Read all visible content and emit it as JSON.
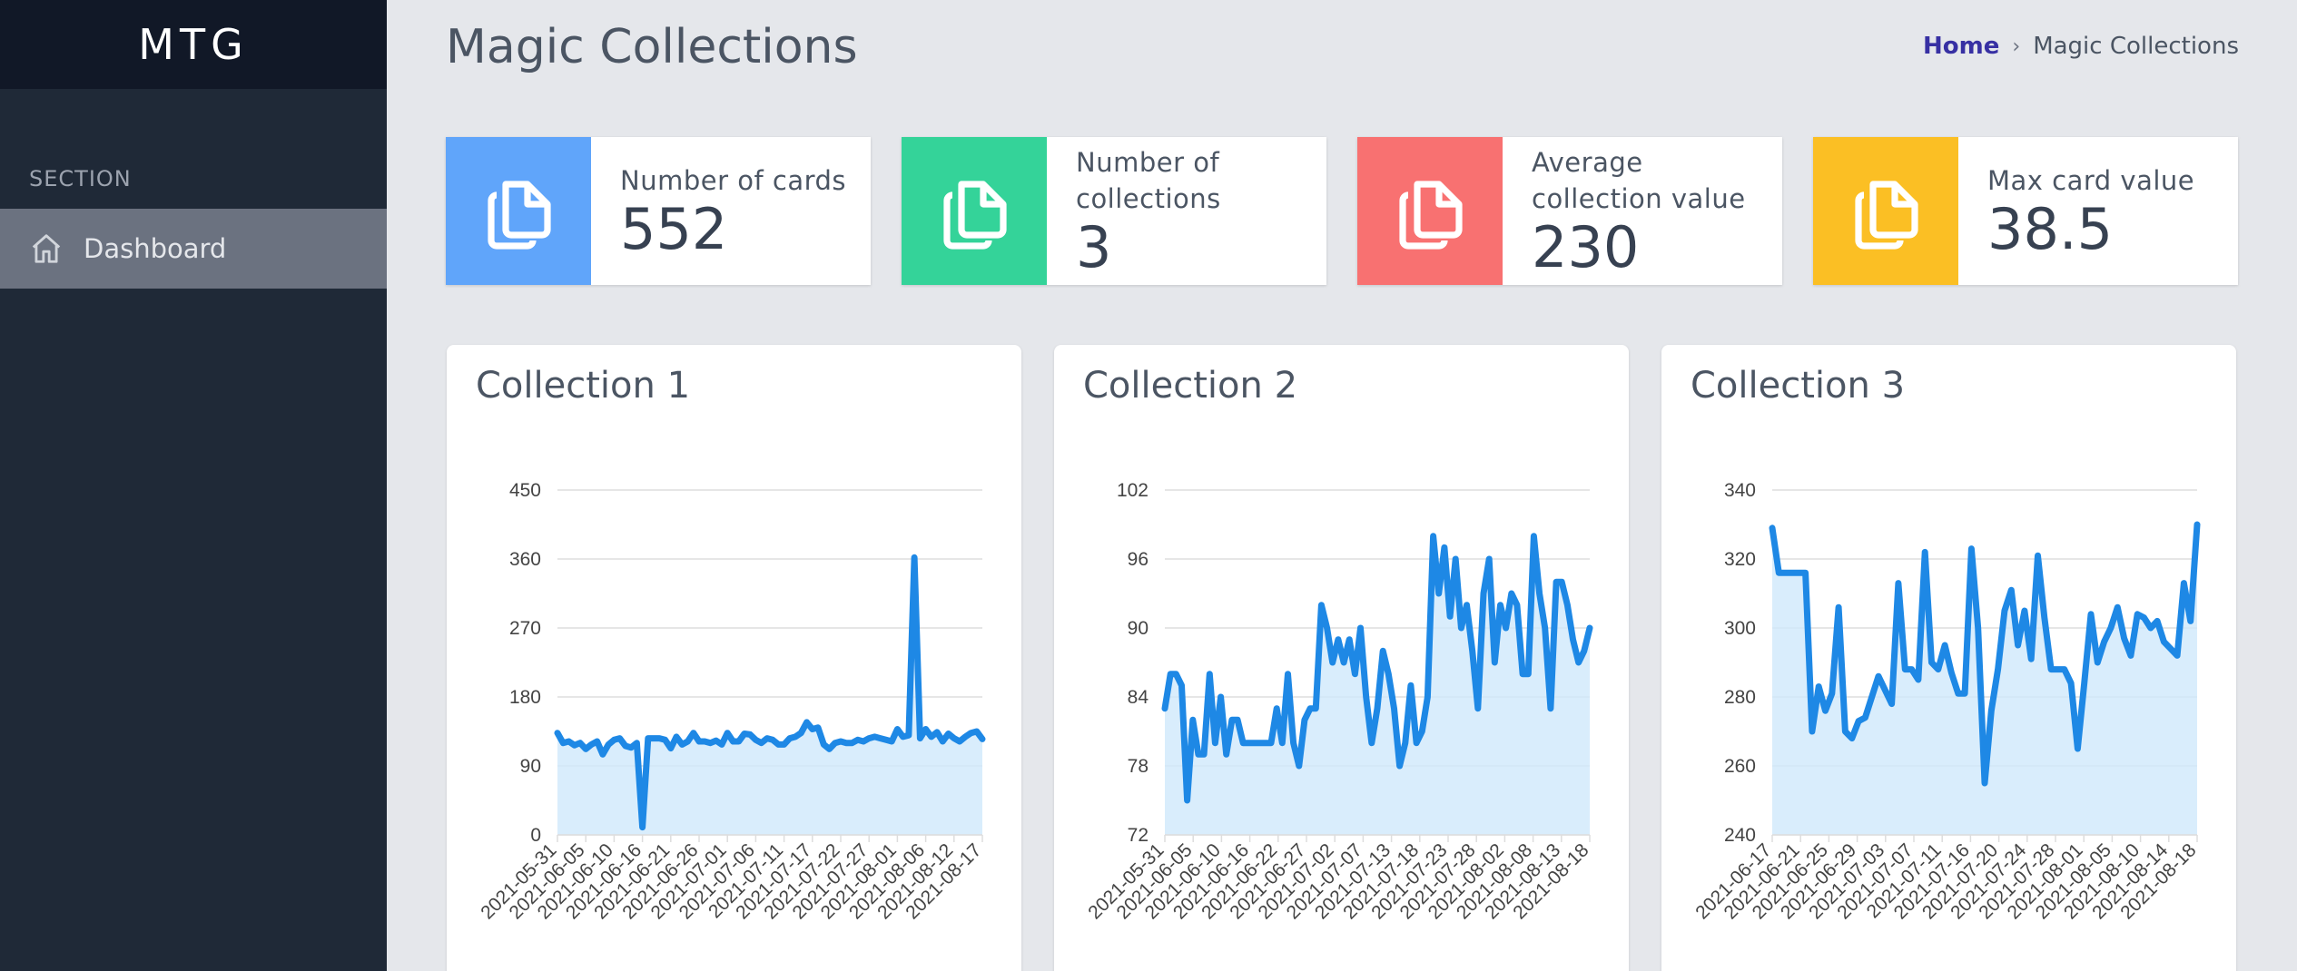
{
  "app": {
    "brand": "MTG"
  },
  "sidebar": {
    "section_label": "SECTION",
    "items": [
      {
        "label": "Dashboard",
        "icon": "home-icon"
      }
    ]
  },
  "header": {
    "title": "Magic Collections",
    "breadcrumb": {
      "home": "Home",
      "separator": "›",
      "current": "Magic Collections"
    }
  },
  "stats": [
    {
      "label": "Number of cards",
      "value": "552",
      "color": "#60a5fa",
      "icon": "copy-icon"
    },
    {
      "label": "Number of collections",
      "value": "3",
      "color": "#34d399",
      "icon": "copy-icon"
    },
    {
      "label": "Average collection value",
      "value": "230",
      "color": "#f87171",
      "icon": "copy-icon"
    },
    {
      "label": "Max card value",
      "value": "38.5",
      "color": "#fbbf24",
      "icon": "copy-icon"
    }
  ],
  "colors": {
    "line": "#1e88e5",
    "fill": "#cfe8fb"
  },
  "chart_data": [
    {
      "type": "area",
      "title": "Collection 1",
      "ylim": [
        0,
        450
      ],
      "yticks": [
        0,
        90,
        180,
        270,
        360,
        450
      ],
      "xticks": [
        "2021-05-31",
        "2021-06-05",
        "2021-06-10",
        "2021-06-16",
        "2021-06-21",
        "2021-06-26",
        "2021-07-01",
        "2021-07-06",
        "2021-07-11",
        "2021-07-17",
        "2021-07-22",
        "2021-07-27",
        "2021-08-01",
        "2021-08-06",
        "2021-08-12",
        "2021-08-17"
      ],
      "values": [
        133,
        120,
        122,
        117,
        120,
        112,
        118,
        122,
        105,
        118,
        124,
        126,
        116,
        114,
        120,
        10,
        126,
        126,
        126,
        124,
        113,
        128,
        118,
        122,
        133,
        122,
        122,
        120,
        123,
        118,
        133,
        122,
        122,
        132,
        131,
        124,
        120,
        126,
        124,
        118,
        118,
        126,
        128,
        133,
        147,
        138,
        140,
        118,
        112,
        120,
        122,
        120,
        120,
        124,
        122,
        126,
        128,
        126,
        124,
        122,
        138,
        128,
        130,
        362,
        126,
        138,
        128,
        134,
        122,
        132,
        126,
        122,
        128,
        133,
        135,
        125
      ]
    },
    {
      "type": "area",
      "title": "Collection 2",
      "ylim": [
        72,
        102
      ],
      "yticks": [
        72,
        78,
        84,
        90,
        96,
        102
      ],
      "xticks": [
        "2021-05-31",
        "2021-06-05",
        "2021-06-10",
        "2021-06-16",
        "2021-06-22",
        "2021-06-27",
        "2021-07-02",
        "2021-07-07",
        "2021-07-13",
        "2021-07-18",
        "2021-07-23",
        "2021-07-28",
        "2021-08-02",
        "2021-08-08",
        "2021-08-13",
        "2021-08-18"
      ],
      "values": [
        83,
        86,
        86,
        85,
        75,
        82,
        79,
        79,
        86,
        80,
        84,
        79,
        82,
        82,
        80,
        80,
        80,
        80,
        80,
        80,
        83,
        80,
        86,
        80,
        78,
        82,
        83,
        83,
        92,
        90,
        87,
        89,
        87,
        89,
        86,
        90,
        84,
        80,
        83,
        88,
        86,
        83,
        78,
        80,
        85,
        80,
        81,
        84,
        98,
        93,
        97,
        91,
        96,
        90,
        92,
        88,
        83,
        93,
        96,
        87,
        92,
        90,
        93,
        92,
        86,
        86,
        98,
        93,
        90,
        83,
        94,
        94,
        92,
        89,
        87,
        88,
        90
      ]
    },
    {
      "type": "area",
      "title": "Collection 3",
      "ylim": [
        240,
        340
      ],
      "yticks": [
        240,
        260,
        280,
        300,
        320,
        340
      ],
      "xticks": [
        "2021-06-17",
        "2021-06-21",
        "2021-06-25",
        "2021-06-29",
        "2021-07-03",
        "2021-07-07",
        "2021-07-11",
        "2021-07-16",
        "2021-07-20",
        "2021-07-24",
        "2021-07-28",
        "2021-08-01",
        "2021-08-05",
        "2021-08-10",
        "2021-08-14",
        "2021-08-18"
      ],
      "values": [
        329,
        316,
        316,
        316,
        316,
        316,
        270,
        283,
        276,
        281,
        306,
        270,
        268,
        273,
        274,
        280,
        286,
        282,
        278,
        313,
        288,
        288,
        285,
        322,
        290,
        288,
        295,
        287,
        281,
        281,
        323,
        300,
        255,
        276,
        288,
        305,
        311,
        295,
        305,
        291,
        321,
        303,
        288,
        288,
        288,
        284,
        265,
        284,
        304,
        290,
        296,
        300,
        306,
        297,
        292,
        304,
        303,
        300,
        302,
        296,
        294,
        292,
        313,
        302,
        330
      ]
    }
  ]
}
